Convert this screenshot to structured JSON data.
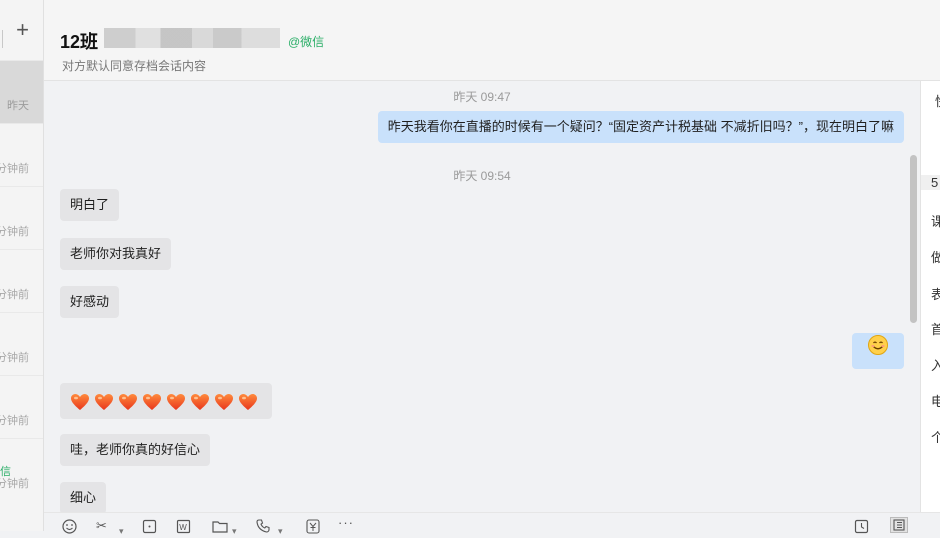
{
  "sidebar": {
    "items": [
      {
        "time": "昨天",
        "active": true
      },
      {
        "time": "分钟前"
      },
      {
        "time": "分钟前"
      },
      {
        "time": "分钟前"
      },
      {
        "time": "分钟前"
      },
      {
        "time": "分钟前"
      },
      {
        "time": "分钟前",
        "tag": "信"
      }
    ]
  },
  "header": {
    "title": "12班",
    "tag": "@微信",
    "subtitle": "对方默认同意存档会话内容"
  },
  "messages": [
    {
      "type": "timestamp",
      "text": "昨天 09:47"
    },
    {
      "type": "out",
      "text": "昨天我看你在直播的时候有一个疑问？“固定资产计税基础 不减折旧吗？”，现在明白了嘛"
    },
    {
      "type": "timestamp",
      "text": "昨天 09:54"
    },
    {
      "type": "in",
      "text": "明白了"
    },
    {
      "type": "in",
      "text": "老师你对我真好"
    },
    {
      "type": "in",
      "text": "好感动"
    },
    {
      "type": "out-emoji",
      "emoji": "smile-emoji"
    },
    {
      "type": "in-emoji",
      "emoji": "heart-emoji",
      "count": 8
    },
    {
      "type": "in",
      "text": "哇，老师你真的好信心"
    },
    {
      "type": "in",
      "text": "细心"
    }
  ],
  "right_panel": {
    "top": "快",
    "items": [
      "5",
      "课",
      "做",
      "表",
      "首",
      "入",
      "电",
      "个"
    ]
  },
  "toolbar": {
    "icons": [
      "emoji-icon",
      "scissors-icon",
      "screenshot-icon",
      "word-doc-icon",
      "folder-icon",
      "phone-icon",
      "yuan-icon",
      "more-icon",
      "send-clock-icon",
      "panel-icon"
    ]
  },
  "colors": {
    "outgoing_bubble": "#c9e1fb",
    "incoming_bubble": "#e4e4e6",
    "accent_green": "#2aae67"
  }
}
